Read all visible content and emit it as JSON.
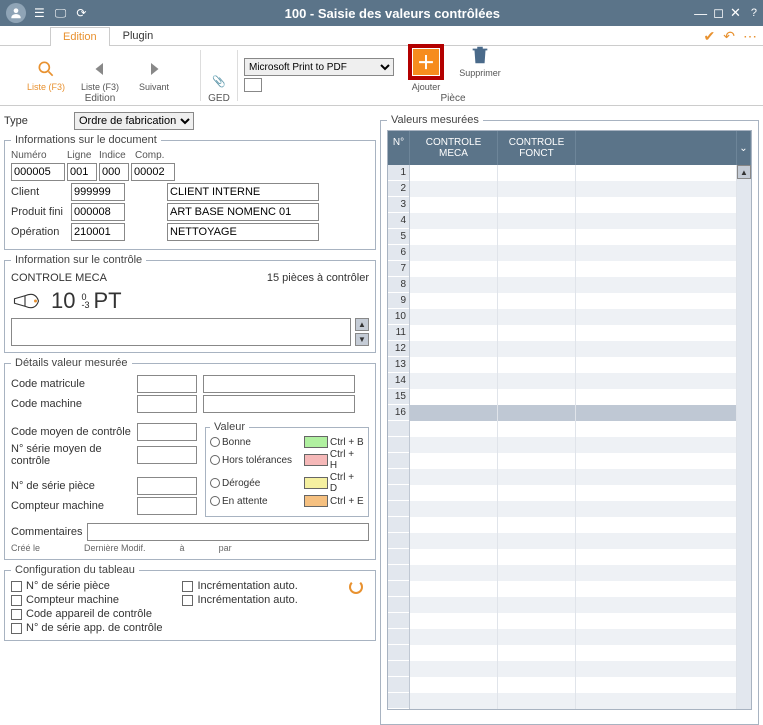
{
  "window": {
    "title": "100 - Saisie des valeurs contrôlées"
  },
  "tabs": {
    "edition": "Edition",
    "plugin": "Plugin"
  },
  "ribbon": {
    "liste": "Liste (F3)",
    "liste2": "Liste (F3)",
    "suivant": "Suivant",
    "group_edition": "Edition",
    "ged": "GED",
    "printer_selected": "Microsoft Print to PDF",
    "ajouter": "Ajouter",
    "supprimer": "Supprimer",
    "piece": "Pièce"
  },
  "type": {
    "label": "Type",
    "value": "Ordre de fabrication"
  },
  "doc": {
    "legend": "Informations sur le document",
    "h_numero": "Numéro",
    "h_ligne": "Ligne",
    "h_indice": "Indice",
    "h_comp": "Comp.",
    "numero": "000005",
    "ligne": "001",
    "indice": "000",
    "comp": "00002",
    "client_lbl": "Client",
    "client_code": "999999",
    "client_name": "CLIENT INTERNE",
    "prodfini_lbl": "Produit fini",
    "prodfini_code": "000008",
    "prodfini_name": "ART BASE NOMENC 01",
    "operation_lbl": "Opération",
    "operation_code": "210001",
    "operation_name": "NETTOYAGE"
  },
  "ctrl": {
    "legend": "Information sur le contrôle",
    "name": "CONTROLE MECA",
    "pieces": "15 pièces à contrôler",
    "tol_up": "0",
    "tol_dn": "-3",
    "value": "10",
    "unit": "PT"
  },
  "details": {
    "legend": "Détails valeur mesurée",
    "matricule": "Code matricule",
    "machine": "Code machine",
    "moyen": "Code moyen de contrôle",
    "nserie_moyen": "N° série moyen de contrôle",
    "nserie_piece": "N° de série pièce",
    "compteur": "Compteur machine",
    "commentaires": "Commentaires",
    "cree": "Créé le",
    "modif": "Dernière Modif.",
    "a": "à",
    "par": "par",
    "valeur": "Valeur",
    "bonne": "Bonne",
    "hors": "Hors tolérances",
    "derogee": "Dérogée",
    "attente": "En attente",
    "ctrl_b": "Ctrl + B",
    "ctrl_h": "Ctrl + H",
    "ctrl_d": "Ctrl + D",
    "ctrl_e": "Ctrl + E"
  },
  "cfg": {
    "legend": "Configuration du tableau",
    "nserie_piece": "N° de série pièce",
    "compteur": "Compteur machine",
    "code_app": "Code appareil de contrôle",
    "nserie_app": "N° de série app. de contrôle",
    "incr1": "Incrémentation auto.",
    "incr2": "Incrémentation auto."
  },
  "measured": {
    "legend": "Valeurs mesurées",
    "col_n": "N°",
    "col1": "CONTROLE MECA",
    "col2": "CONTROLE FONCT",
    "rows": [
      "1",
      "2",
      "3",
      "4",
      "5",
      "6",
      "7",
      "8",
      "9",
      "10",
      "11",
      "12",
      "13",
      "14",
      "15",
      "16"
    ]
  }
}
